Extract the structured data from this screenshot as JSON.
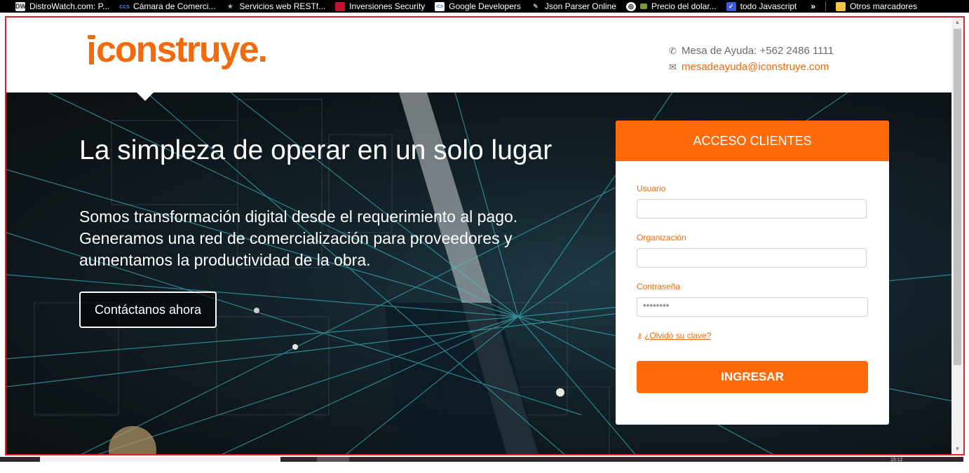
{
  "bookmarks": [
    {
      "label": "DistroWatch.com: P...",
      "icon": "distrowatch-icon",
      "color": "#e8e8e8"
    },
    {
      "label": "Cámara de Comerci...",
      "icon": "ccs-icon",
      "color": "#1a4aa8"
    },
    {
      "label": "Servicios web RESTf...",
      "icon": "star-icon",
      "color": "#888888"
    },
    {
      "label": "Inversiones Security",
      "icon": "security-icon",
      "color": "#c8102e"
    },
    {
      "label": "Google Developers",
      "icon": "google-developers-icon",
      "color": "#4285f4"
    },
    {
      "label": "Json Parser Online",
      "icon": "json-icon",
      "color": "#777777"
    },
    {
      "label": "Precio del dolar...",
      "icon": "globe-icon",
      "color": "#ffffff"
    },
    {
      "label": "todo Javascript",
      "icon": "checkbox-icon",
      "color": "#3b5bdb"
    }
  ],
  "bookmarks_more": "»",
  "bookmarks_other": "Otros marcadores",
  "header": {
    "logo_text": "construye.",
    "phone": "Mesa de Ayuda: +562 2486 1111",
    "email": "mesadeayuda@iconstruye.com"
  },
  "hero": {
    "title": "La simpleza de operar en un solo lugar",
    "subtitle": "Somos transformación digital desde el requerimiento al pago. Generamos una red de comercialización para proveedores y aumentamos la productividad de la obra.",
    "cta": "Contáctanos ahora"
  },
  "login": {
    "heading": "ACCESO CLIENTES",
    "user_label": "Usuario",
    "user_value": "",
    "org_label": "Organización",
    "org_value": "",
    "password_label": "Contraseña",
    "password_value": "********",
    "forgot": "¿Olvidó su clave?",
    "submit": "INGRESAR"
  },
  "colors": {
    "brand": "#ff6b0a",
    "frame_border": "#d9232d"
  },
  "taskbar": {
    "time": "15:12"
  }
}
